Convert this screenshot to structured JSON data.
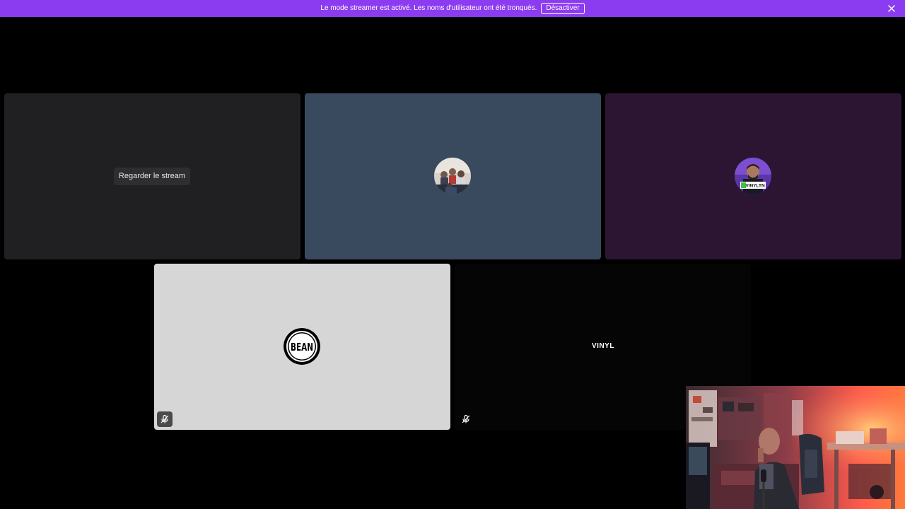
{
  "banner": {
    "message": "Le mode streamer est activé. Les noms d'utilisateur ont été tronqués.",
    "disable_label": "Désactiver",
    "close_icon": "close-icon",
    "color": "#8c3cf0"
  },
  "tiles": [
    {
      "bg": "#202022",
      "action_label": "Regarder le stream"
    },
    {
      "bg": "#394a5e",
      "avatar": "group-photo-avatar"
    },
    {
      "bg": "#2c1533",
      "avatar": "vinyl-avatar",
      "avatar_tag": "VINYLTN"
    },
    {
      "bg": "#d6d6d6",
      "avatar": "bean-logo-avatar",
      "logo_text": "BEAN",
      "status_icon": "mic-muted-icon"
    },
    {
      "bg": "#050505",
      "name_label": "VINYL",
      "status_icon": "mic-muted-icon"
    }
  ],
  "webcam": {
    "icon": "webcam-overlay"
  }
}
